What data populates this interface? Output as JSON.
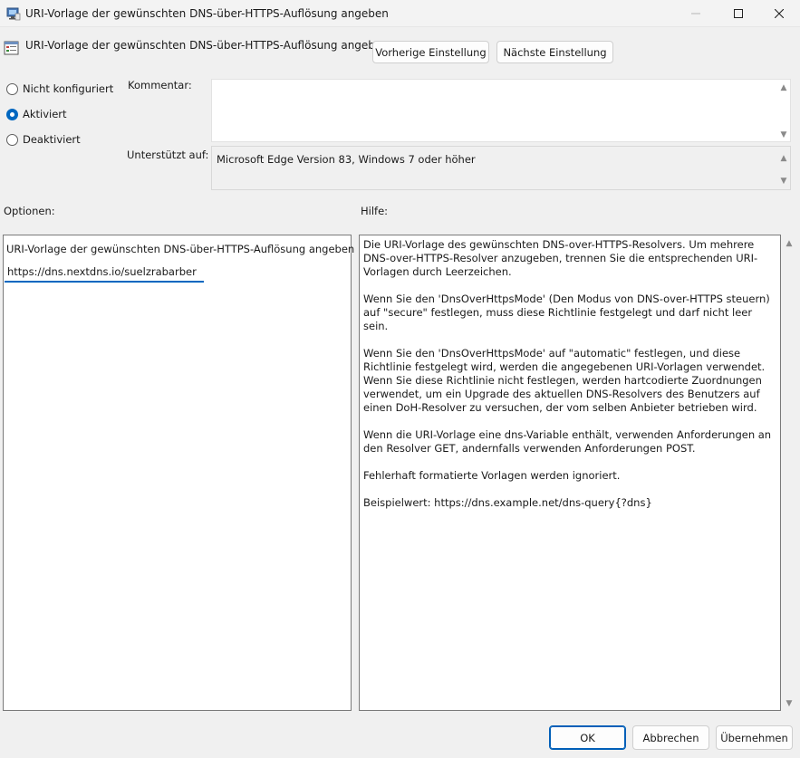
{
  "window": {
    "title": "URI-Vorlage der gewünschten DNS-über-HTTPS-Auflösung angeben",
    "icon": "policy-app-icon",
    "controls": {
      "minimize": "—",
      "maximize": "☐",
      "close": "✕"
    }
  },
  "header": {
    "policy_title": "URI-Vorlage der gewünschten DNS-über-HTTPS-Auflösung angeben",
    "prev_button": "Vorherige Einstellung",
    "next_button": "Nächste Einstellung"
  },
  "state": {
    "options": [
      {
        "label": "Nicht konfiguriert",
        "checked": false
      },
      {
        "label": "Aktiviert",
        "checked": true
      },
      {
        "label": "Deaktiviert",
        "checked": false
      }
    ]
  },
  "comment": {
    "label": "Kommentar:",
    "value": ""
  },
  "supported": {
    "label": "Unterstützt auf:",
    "value": "Microsoft Edge Version 83, Windows 7 oder höher"
  },
  "options_section": {
    "label": "Optionen:",
    "field_label": "URI-Vorlage der gewünschten DNS-über-HTTPS-Auflösung angeben",
    "field_value": "https://dns.nextdns.io/suelzrabarber"
  },
  "help_section": {
    "label": "Hilfe:",
    "paragraphs": [
      "Die URI-Vorlage des gewünschten DNS-over-HTTPS-Resolvers. Um mehrere DNS-over-HTTPS-Resolver anzugeben, trennen Sie die entsprechenden URI-Vorlagen durch Leerzeichen.",
      "Wenn Sie den 'DnsOverHttpsMode' (Den Modus von DNS-over-HTTPS steuern) auf \"secure\" festlegen, muss diese Richtlinie festgelegt und darf nicht leer sein.",
      "Wenn Sie den 'DnsOverHttpsMode' auf \"automatic\" festlegen, und diese Richtlinie festgelegt wird, werden die angegebenen URI-Vorlagen verwendet. Wenn Sie diese Richtlinie nicht festlegen, werden hartcodierte Zuordnungen verwendet, um ein Upgrade des aktuellen DNS-Resolvers des Benutzers auf einen DoH-Resolver zu versuchen, der vom selben Anbieter betrieben wird.",
      "Wenn die URI-Vorlage eine dns-Variable enthält, verwenden Anforderungen an den Resolver GET, andernfalls verwenden Anforderungen POST.",
      "Fehlerhaft formatierte Vorlagen werden ignoriert.",
      "Beispielwert: https://dns.example.net/dns-query{?dns}"
    ]
  },
  "footer": {
    "ok": "OK",
    "cancel": "Abbrechen",
    "apply": "Übernehmen"
  },
  "colors": {
    "accent": "#0067c0"
  }
}
